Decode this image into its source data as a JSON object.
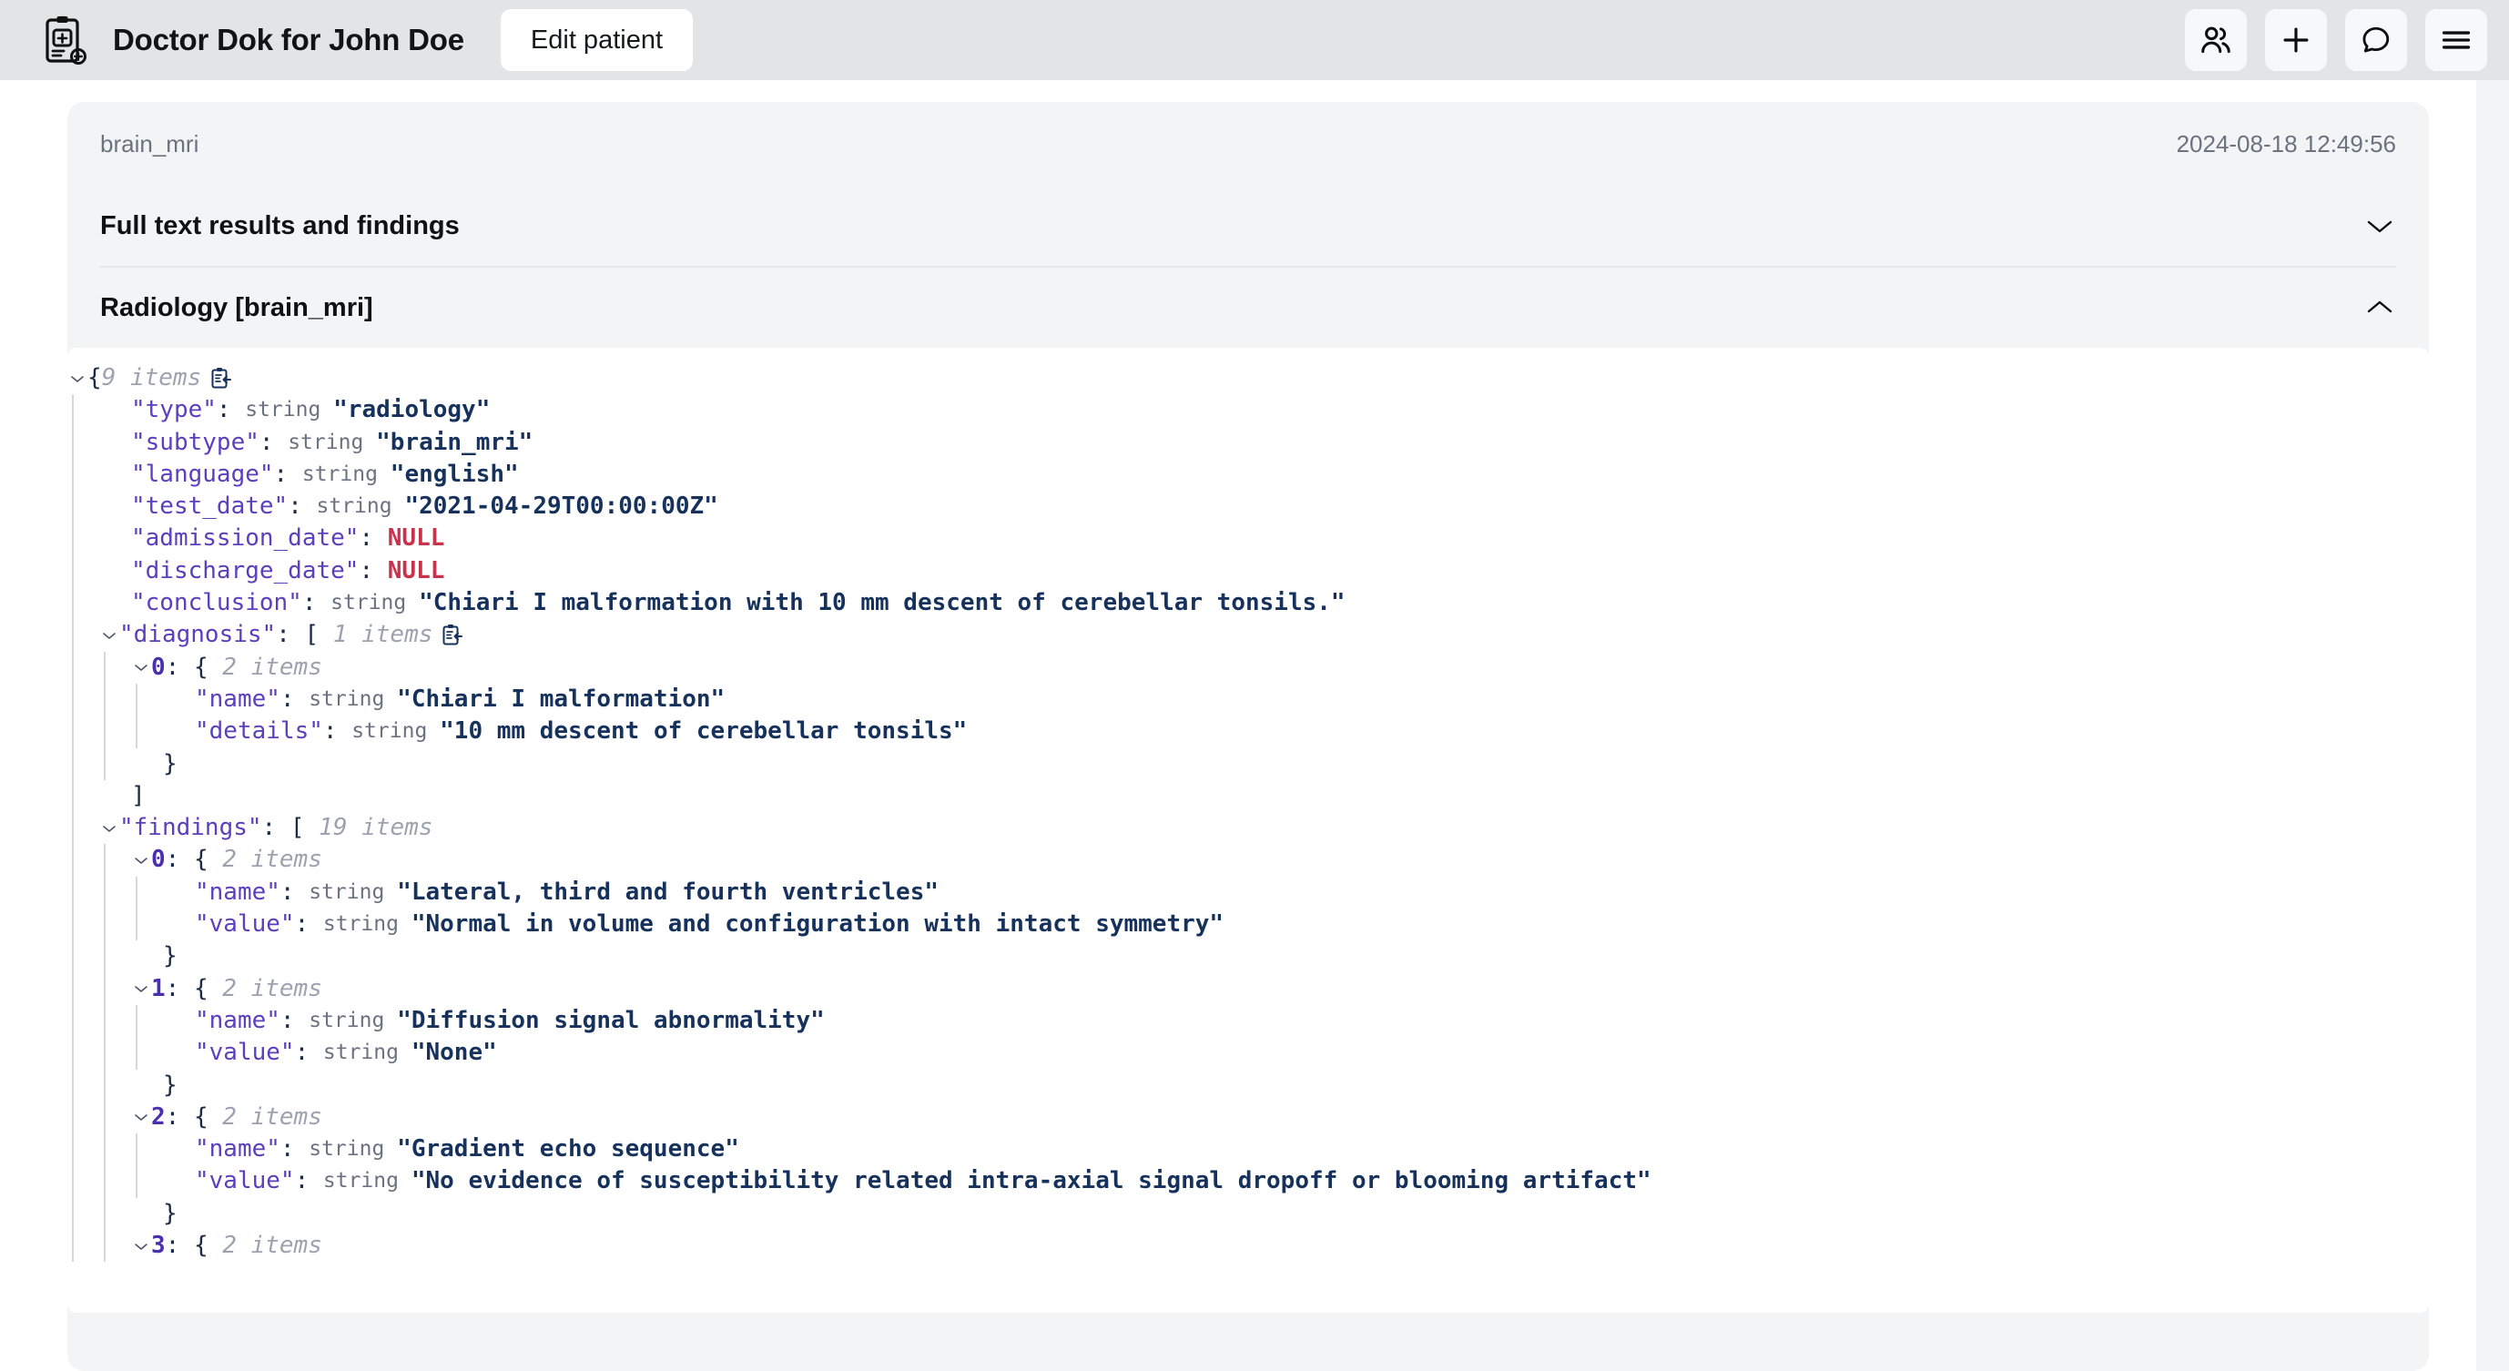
{
  "topbar": {
    "logo_icon": "clipboard-medical-icon",
    "app_title": "Doctor Dok for John Doe",
    "edit_patient_label": "Edit patient",
    "actions": [
      {
        "name": "patients-icon",
        "label": "Patients"
      },
      {
        "name": "plus-icon",
        "label": "Add"
      },
      {
        "name": "chat-bubble-icon",
        "label": "Chat"
      },
      {
        "name": "hamburger-menu-icon",
        "label": "Menu"
      }
    ]
  },
  "record": {
    "subtype_label": "brain_mri",
    "timestamp": "2024-08-18 12:49:56"
  },
  "accordions": [
    {
      "title": "Full text results and findings",
      "expanded": false,
      "chevron": "chevron-down-icon"
    },
    {
      "title": "Radiology [brain_mri]",
      "expanded": true,
      "chevron": "chevron-up-icon"
    }
  ],
  "json_viewer": {
    "root_brace": "{",
    "root_count": "9 items",
    "copy_icon": "copy-to-clipboard-icon",
    "type_label": "string",
    "null_label": "NULL",
    "rows": [
      {
        "depth": 0,
        "kind": "root-open",
        "brace": "{",
        "count": "9 items",
        "copy": true
      },
      {
        "depth": 1,
        "kind": "pair",
        "key": "\"type\"",
        "type": "string",
        "value": "\"radiology\""
      },
      {
        "depth": 1,
        "kind": "pair",
        "key": "\"subtype\"",
        "type": "string",
        "value": "\"brain_mri\""
      },
      {
        "depth": 1,
        "kind": "pair",
        "key": "\"language\"",
        "type": "string",
        "value": "\"english\""
      },
      {
        "depth": 1,
        "kind": "pair",
        "key": "\"test_date\"",
        "type": "string",
        "value": "\"2021-04-29T00:00:00Z\""
      },
      {
        "depth": 1,
        "kind": "null",
        "key": "\"admission_date\"",
        "value": "NULL"
      },
      {
        "depth": 1,
        "kind": "null",
        "key": "\"discharge_date\"",
        "value": "NULL"
      },
      {
        "depth": 1,
        "kind": "pair",
        "key": "\"conclusion\"",
        "type": "string",
        "value": "\"Chiari I malformation with 10 mm descent of cerebellar tonsils.\""
      },
      {
        "depth": 1,
        "kind": "open",
        "key": "\"diagnosis\"",
        "brace": "[",
        "count": "1 items",
        "copy": true
      },
      {
        "depth": 2,
        "kind": "open-idx",
        "key": "0",
        "brace": "{",
        "count": "2 items",
        "copy": false
      },
      {
        "depth": 3,
        "kind": "pair",
        "key": "\"name\"",
        "type": "string",
        "value": "\"Chiari I malformation\""
      },
      {
        "depth": 3,
        "kind": "pair",
        "key": "\"details\"",
        "type": "string",
        "value": "\"10 mm descent of cerebellar tonsils\""
      },
      {
        "depth": 2,
        "kind": "close",
        "brace": "}"
      },
      {
        "depth": 1,
        "kind": "close",
        "brace": "]"
      },
      {
        "depth": 1,
        "kind": "open",
        "key": "\"findings\"",
        "brace": "[",
        "count": "19 items",
        "copy": false
      },
      {
        "depth": 2,
        "kind": "open-idx",
        "key": "0",
        "brace": "{",
        "count": "2 items",
        "copy": false
      },
      {
        "depth": 3,
        "kind": "pair",
        "key": "\"name\"",
        "type": "string",
        "value": "\"Lateral, third and fourth ventricles\""
      },
      {
        "depth": 3,
        "kind": "pair",
        "key": "\"value\"",
        "type": "string",
        "value": "\"Normal in volume and configuration with intact symmetry\""
      },
      {
        "depth": 2,
        "kind": "close",
        "brace": "}"
      },
      {
        "depth": 2,
        "kind": "open-idx",
        "key": "1",
        "brace": "{",
        "count": "2 items",
        "copy": false
      },
      {
        "depth": 3,
        "kind": "pair",
        "key": "\"name\"",
        "type": "string",
        "value": "\"Diffusion signal abnormality\""
      },
      {
        "depth": 3,
        "kind": "pair",
        "key": "\"value\"",
        "type": "string",
        "value": "\"None\""
      },
      {
        "depth": 2,
        "kind": "close",
        "brace": "}"
      },
      {
        "depth": 2,
        "kind": "open-idx",
        "key": "2",
        "brace": "{",
        "count": "2 items",
        "copy": false
      },
      {
        "depth": 3,
        "kind": "pair",
        "key": "\"name\"",
        "type": "string",
        "value": "\"Gradient echo sequence\""
      },
      {
        "depth": 3,
        "kind": "pair",
        "key": "\"value\"",
        "type": "string",
        "value": "\"No evidence of susceptibility related intra-axial signal dropoff or blooming artifact\""
      },
      {
        "depth": 2,
        "kind": "close",
        "brace": "}"
      },
      {
        "depth": 2,
        "kind": "open-idx",
        "key": "3",
        "brace": "{",
        "count": "2 items",
        "copy": false
      }
    ]
  },
  "colors": {
    "topbar_bg": "#e3e4e6",
    "panel_bg": "#f3f4f5",
    "key": "#5b3fbe",
    "index": "#4a2fb0",
    "string": "#16325c",
    "null": "#c8324b",
    "count": "#9ca3af",
    "type": "#6b7280"
  }
}
